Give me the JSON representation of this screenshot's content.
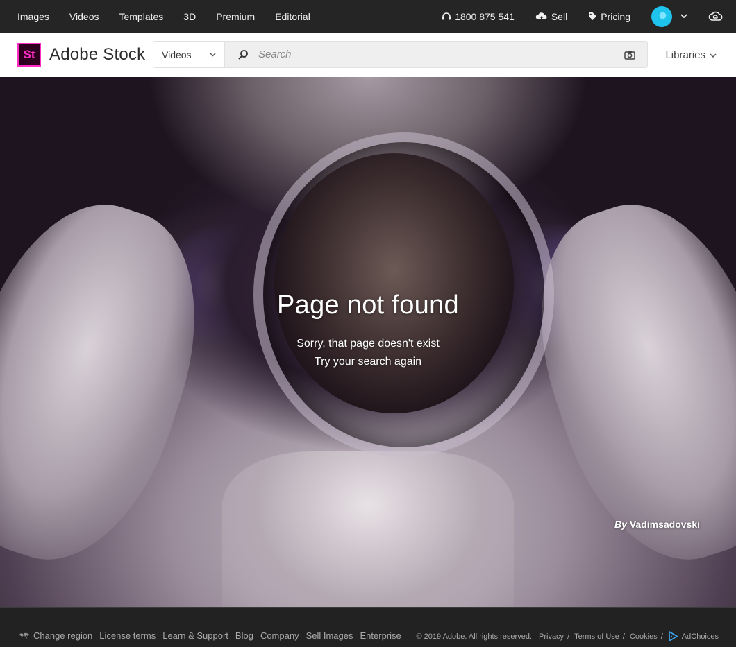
{
  "topnav": {
    "links": [
      "Images",
      "Videos",
      "Templates",
      "3D",
      "Premium",
      "Editorial"
    ],
    "phone": "1800 875 541",
    "sell": "Sell",
    "pricing": "Pricing"
  },
  "header": {
    "logo_letters": "St",
    "logo_text": "Adobe Stock",
    "search_type": "Videos",
    "search_placeholder": "Search",
    "libraries": "Libraries"
  },
  "hero": {
    "title": "Page not found",
    "subtitle_1": "Sorry, that page doesn't exist",
    "subtitle_2": "Try your search again",
    "credit_by": "By",
    "credit_author": "Vadimsadovski"
  },
  "footer": {
    "links": [
      "Change region",
      "License terms",
      "Learn & Support",
      "Blog",
      "Company",
      "Sell Images",
      "Enterprise"
    ],
    "copyright": "© 2019 Adobe. All rights reserved.",
    "legal": [
      "Privacy",
      "Terms of Use",
      "Cookies"
    ],
    "adchoices": "AdChoices"
  },
  "colors": {
    "topnav_bg": "#252525",
    "logo_pink": "#ff2bc2",
    "logo_bg": "#2e001f",
    "avatar": "#1ec3ee",
    "footer_bg": "#222222"
  },
  "icons": [
    "headset-icon",
    "cloud-upload-icon",
    "tag-icon",
    "chevron-down-icon",
    "creative-cloud-icon",
    "search-icon",
    "camera-icon",
    "globe-icon",
    "adchoices-icon"
  ]
}
